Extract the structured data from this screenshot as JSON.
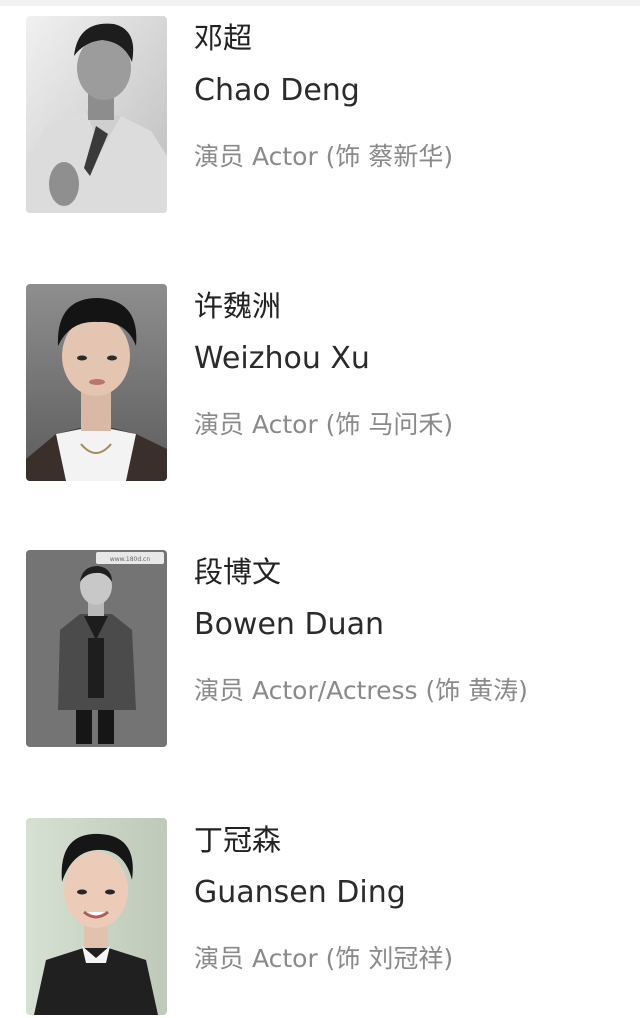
{
  "cast": [
    {
      "name_zh": "邓超",
      "name_en": "Chao Deng",
      "role": "演员 Actor (饰 蔡新华)",
      "photo_alt": "chao-deng-portrait"
    },
    {
      "name_zh": "许魏洲",
      "name_en": "Weizhou Xu",
      "role": "演员 Actor (饰 马问禾)",
      "photo_alt": "weizhou-xu-portrait"
    },
    {
      "name_zh": "段博文",
      "name_en": "Bowen Duan",
      "role": "演员 Actor/Actress (饰 黄涛)",
      "photo_alt": "bowen-duan-portrait",
      "photo_watermark": "www.180d.cn"
    },
    {
      "name_zh": "丁冠森",
      "name_en": "Guansen Ding",
      "role": "演员 Actor (饰 刘冠祥)",
      "photo_alt": "guansen-ding-portrait"
    }
  ],
  "colors": {
    "name": "#222222",
    "role": "#8a8a8a",
    "background": "#ffffff"
  }
}
